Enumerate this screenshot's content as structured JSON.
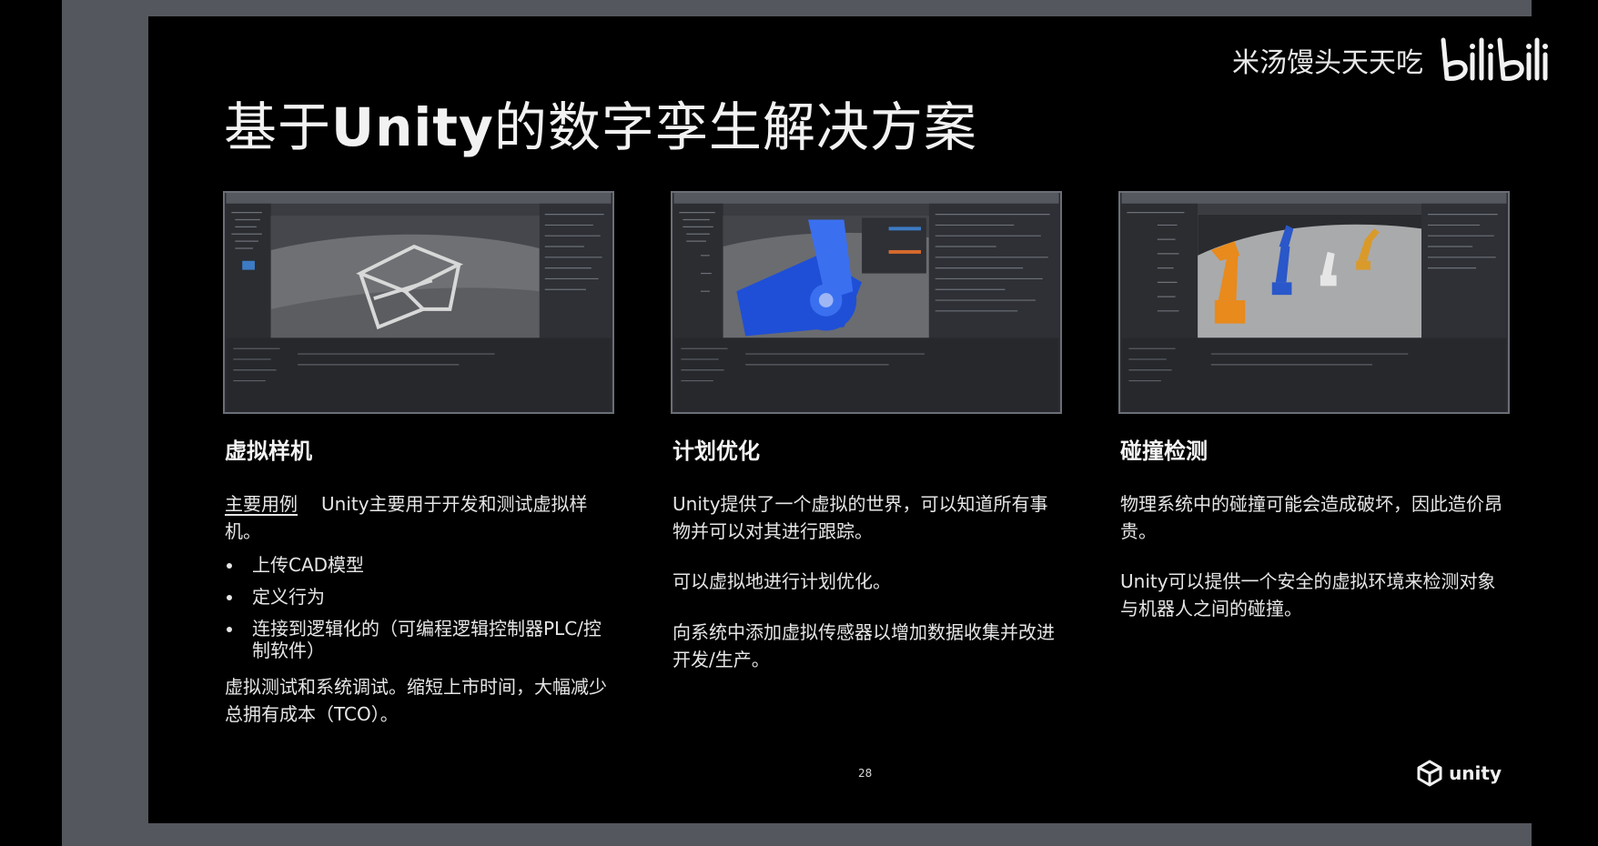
{
  "slide": {
    "title_prefix": "基于",
    "title_brand": "Unity",
    "title_suffix": "的数字孪生解决方案",
    "page_number": "28",
    "brand_logo_text": "unity"
  },
  "watermark": {
    "uploader": "米汤馒头天天吃",
    "site_logo": "bilibili"
  },
  "columns": [
    {
      "heading": "虚拟样机",
      "screenshot": "unity-editor-scene-frame-structure",
      "intro_label": "主要用例",
      "intro_text": "Unity主要用于开发和测试虚拟样机。",
      "bullets": [
        "上传CAD模型",
        "定义行为",
        "连接到逻辑化的（可编程逻辑控制器PLC/控制软件）"
      ],
      "outro": "虚拟测试和系统调试。缩短上市时间，大幅减少总拥有成本（TCO）。"
    },
    {
      "heading": "计划优化",
      "screenshot": "unity-editor-scene-blue-robot-arm",
      "paragraphs": [
        "Unity提供了一个虚拟的世界，可以知道所有事物并可以对其进行跟踪。",
        "可以虚拟地进行计划优化。",
        "向系统中添加虚拟传感器以增加数据收集并改进开发/生产。"
      ]
    },
    {
      "heading": "碰撞检测",
      "screenshot": "unity-editor-scene-robot-arms-collision",
      "paragraphs": [
        "物理系统中的碰撞可能会造成破坏，因此造价昂贵。",
        "Unity可以提供一个安全的虚拟环境来检测对象与机器人之间的碰撞。"
      ]
    }
  ]
}
